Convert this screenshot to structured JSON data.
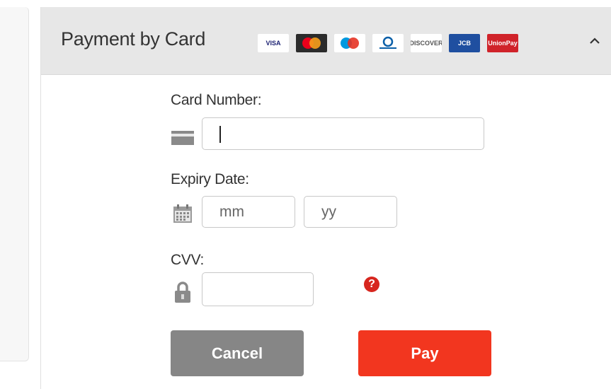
{
  "panel": {
    "title": "Payment by Card",
    "card_logos": [
      {
        "name": "visa-logo",
        "text": "VISA",
        "bg": "#ffffff",
        "fg": "#1a1f71"
      },
      {
        "name": "mastercard-logo",
        "text": "",
        "bg": "#2b2b2b",
        "fg": "#ffffff"
      },
      {
        "name": "maestro-logo",
        "text": "",
        "bg": "#ffffff",
        "fg": "#1f78c9"
      },
      {
        "name": "diners-club-logo",
        "text": "",
        "bg": "#ffffff",
        "fg": "#0a5fa8"
      },
      {
        "name": "discover-logo",
        "text": "DISCOVER",
        "bg": "#ffffff",
        "fg": "#555555"
      },
      {
        "name": "jcb-logo",
        "text": "JCB",
        "bg": "#1f4fa0",
        "fg": "#ffffff"
      },
      {
        "name": "unionpay-logo",
        "text": "UnionPay",
        "bg": "#d0232a",
        "fg": "#ffffff"
      }
    ]
  },
  "form": {
    "card_number_label": "Card Number:",
    "card_number_value": "",
    "expiry_label": "Expiry Date:",
    "month_placeholder": "mm",
    "year_placeholder": "yy",
    "cvv_label": "CVV:",
    "cvv_value": "",
    "help_symbol": "?"
  },
  "buttons": {
    "cancel_label": "Cancel",
    "pay_label": "Pay"
  },
  "colors": {
    "header_bg": "#e7e7e7",
    "pay_button": "#f2361f",
    "cancel_button": "#868686",
    "help_icon": "#d7261e"
  },
  "icons": {
    "card": "credit-card-icon",
    "calendar": "calendar-icon",
    "lock": "lock-icon",
    "help": "question-icon",
    "collapse": "chevron-up-icon"
  }
}
